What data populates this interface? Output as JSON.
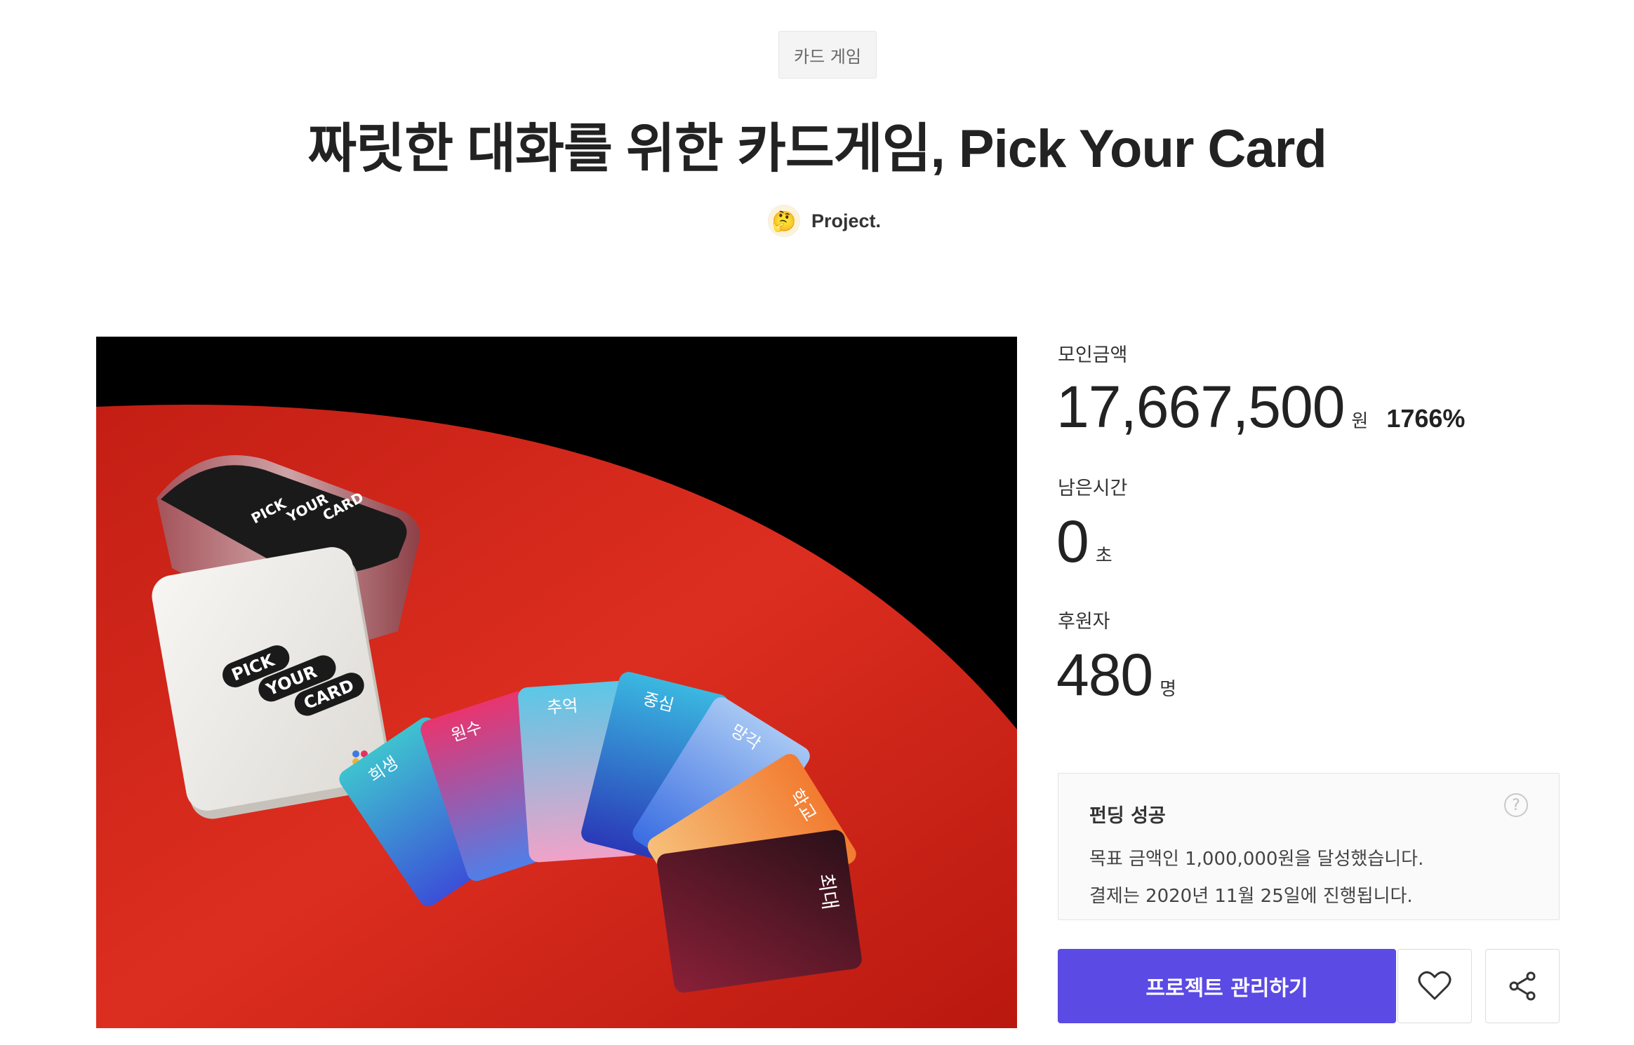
{
  "category": "카드 게임",
  "title": "짜릿한 대화를 위한 카드게임, Pick Your Card",
  "creator": {
    "name": "Project.",
    "avatar_icon": "thinking-face-icon"
  },
  "hero": {
    "tin_lid_text": [
      "PICK",
      "YOUR",
      "CARD"
    ],
    "cards": [
      "희생",
      "원수",
      "추억",
      "중심",
      "망각",
      "학교",
      "최대"
    ]
  },
  "stats": {
    "amount": {
      "label": "모인금액",
      "value": "17,667,500",
      "unit": "원",
      "percent": "1766%"
    },
    "time_left": {
      "label": "남은시간",
      "value": "0",
      "unit": "초"
    },
    "backers": {
      "label": "후원자",
      "value": "480",
      "unit": "명"
    }
  },
  "success": {
    "title": "펀딩 성공",
    "line1": "목표 금액인 1,000,000원을 달성했습니다.",
    "line2": "결제는 2020년 11월 25일에 진행됩니다.",
    "help_icon": "?"
  },
  "actions": {
    "manage_label": "프로젝트 관리하기",
    "like_icon": "heart-icon",
    "share_icon": "share-icon"
  },
  "colors": {
    "accent": "#5b4ae4",
    "table_red": "#d62a1e"
  }
}
